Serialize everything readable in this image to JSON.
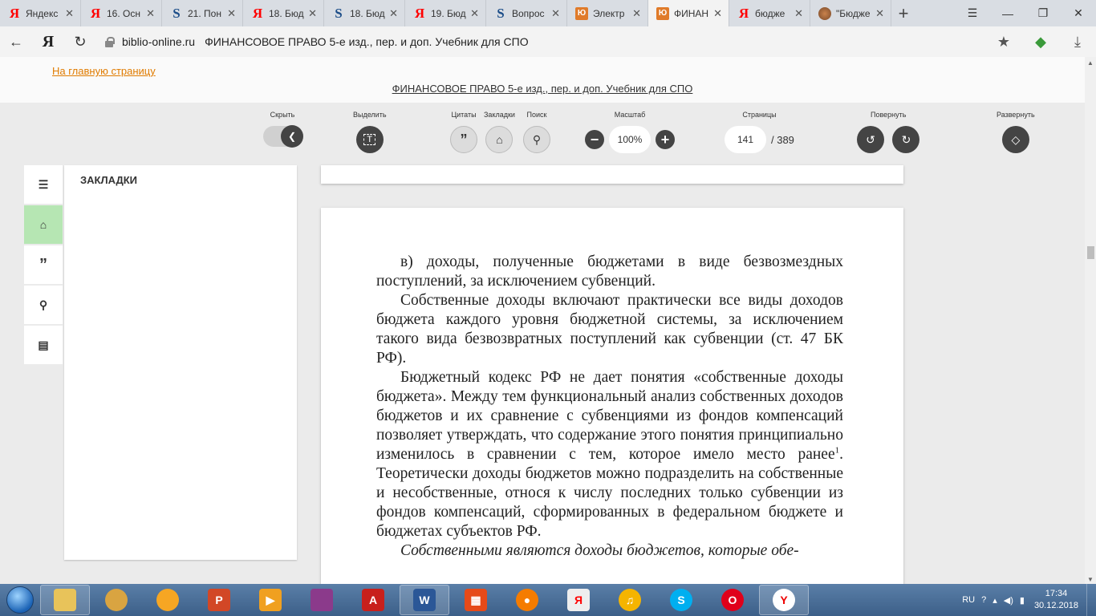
{
  "browser": {
    "tabs": [
      {
        "icon": "yandex-icon",
        "glyph": "Я",
        "cls": "ya",
        "label": "Яндекс",
        "active": false
      },
      {
        "icon": "yandex-icon",
        "glyph": "Я",
        "cls": "ya",
        "label": "16. Осн",
        "active": false
      },
      {
        "icon": "studfiles-icon",
        "glyph": "S",
        "cls": "s",
        "label": "21. Пон",
        "active": false
      },
      {
        "icon": "yandex-icon",
        "glyph": "Я",
        "cls": "ya",
        "label": "18. Бюд",
        "active": false
      },
      {
        "icon": "studfiles-icon",
        "glyph": "S",
        "cls": "s",
        "label": "18. Бюд",
        "active": false
      },
      {
        "icon": "yandex-icon",
        "glyph": "Я",
        "cls": "ya",
        "label": "19. Бюд",
        "active": false
      },
      {
        "icon": "studfiles-icon",
        "glyph": "S",
        "cls": "s",
        "label": "Вопрос",
        "active": false
      },
      {
        "icon": "urait-icon",
        "glyph": "Ю",
        "cls": "u",
        "label": "Электр",
        "active": false
      },
      {
        "icon": "urait-icon",
        "glyph": "Ю",
        "cls": "u",
        "label": "ФИНАН",
        "active": true
      },
      {
        "icon": "yandex-icon",
        "glyph": "Я",
        "cls": "ya",
        "label": "бюдже",
        "active": false
      },
      {
        "icon": "image-icon",
        "glyph": "",
        "cls": "img",
        "label": "\"Бюдже",
        "active": false
      }
    ],
    "new_tab": "+",
    "address": {
      "host": "biblio-online.ru",
      "title": "ФИНАНСОВОЕ ПРАВО 5-е изд., пер. и доп. Учебник для СПО"
    }
  },
  "page": {
    "home_link": "На главную страницу",
    "book_link": "ФИНАНСОВОЕ ПРАВО 5-е изд., пер. и доп. Учебник для СПО"
  },
  "toolbar": {
    "hide_label": "Скрыть",
    "select_label": "Выделить",
    "quotes_label": "Цитаты",
    "bookmarks_label": "Закладки",
    "search_label": "Поиск",
    "zoom_label": "Масштаб",
    "zoom_value": "100%",
    "pages_label": "Страницы",
    "current_page": "141",
    "total_pages": "/ 389",
    "rotate_label": "Повернуть",
    "expand_label": "Развернуть"
  },
  "bookmarks_panel": {
    "title": "ЗАКЛАДКИ"
  },
  "book_text": {
    "p1": "в) доходы, полученные бюджетами в виде безвозмездных поступлений, за исключением субвенций.",
    "p2": "Собственные доходы включают практически все виды доходов бюджета каждого уровня бюджетной системы, за исключением такого вида безвозвратных поступлений как субвенции (ст. 47 БК РФ).",
    "p3a": "Бюджетный кодекс РФ не дает понятия «собственные доходы бюджета». Между тем функциональный анализ собственных доходов бюджетов и их сравнение с субвенциями из фондов компенсаций позволяет утверждать, что содержание этого понятия принципиально изменилось в сравнении с тем, которое имело место ранее",
    "p3_footnote": "1",
    "p3b": ". Теоретически доходы бюджетов можно подразделить на собственные и несобственные, относя к числу последних только субвенции из фондов компенсаций, сформированных в федеральном бюджете и бюджетах субъектов РФ.",
    "p4": "Собственными являются доходы бюджетов, которые обе-"
  },
  "taskbar": {
    "language": "RU",
    "time": "17:34",
    "date": "30.12.2018"
  }
}
